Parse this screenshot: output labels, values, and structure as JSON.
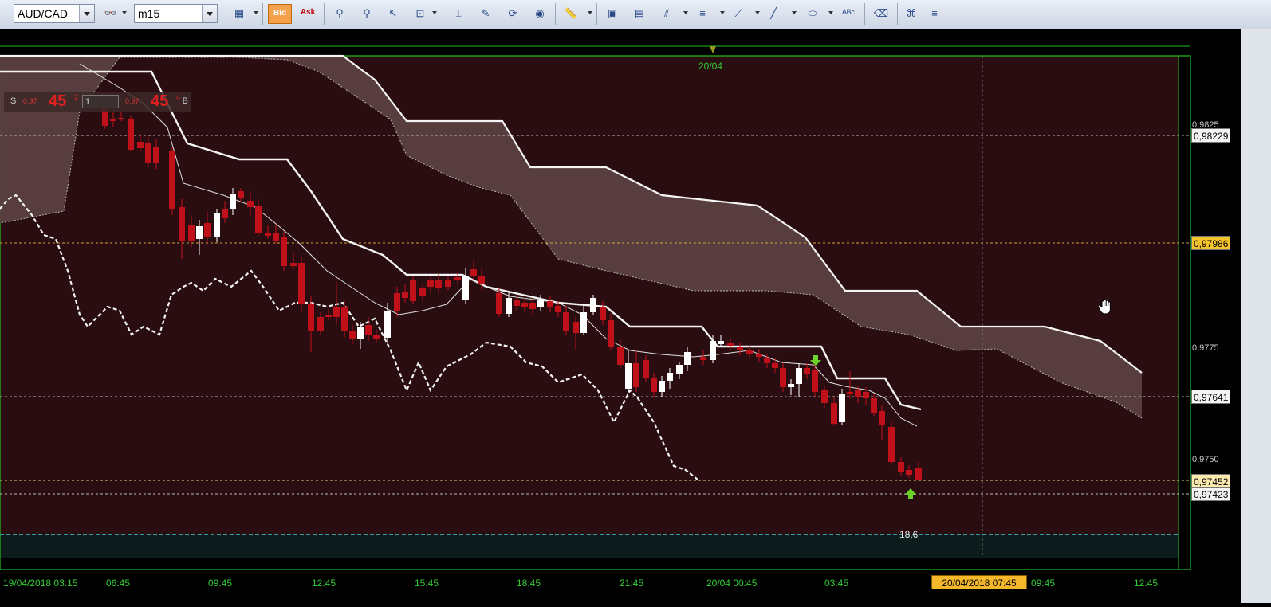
{
  "toolbar": {
    "symbol": "AUD/CAD",
    "timeframe": "m15",
    "bid_label": "Bid",
    "ask_label": "Ask"
  },
  "quote_panel": {
    "sell_label": "S",
    "buy_label": "B",
    "sell_prefix": "0,97",
    "sell_big": "45",
    "sell_sup": "2",
    "buy_prefix": "0,97",
    "buy_big": "45",
    "buy_sup": "4",
    "lot_value": "1"
  },
  "chart": {
    "date_marker": "20/04",
    "price_labels": [
      {
        "text": "0,98229",
        "style": "white"
      },
      {
        "text": "0,97986",
        "style": "yellow"
      },
      {
        "text": "0,97641",
        "style": "white"
      },
      {
        "text": "0,97452",
        "style": "yellow-light"
      },
      {
        "text": "0,97423",
        "style": "white"
      }
    ],
    "y_ticks": [
      "0,9825",
      "0,9775",
      "0,9750"
    ],
    "x_ticks": [
      "19/04/2018 03:15",
      "06:45",
      "09:45",
      "12:45",
      "15:45",
      "18:45",
      "21:45",
      "20/04 00:45",
      "03:45",
      "09:45",
      "12:45"
    ],
    "x_highlight": "20/04/2018 07:45",
    "annotation_value": "18,6",
    "colors": {
      "background": "#2a0d10",
      "bull": "#ffffff",
      "bear": "#c0101a",
      "frame": "#1fbf1f",
      "cloud": "#5a4040"
    }
  }
}
